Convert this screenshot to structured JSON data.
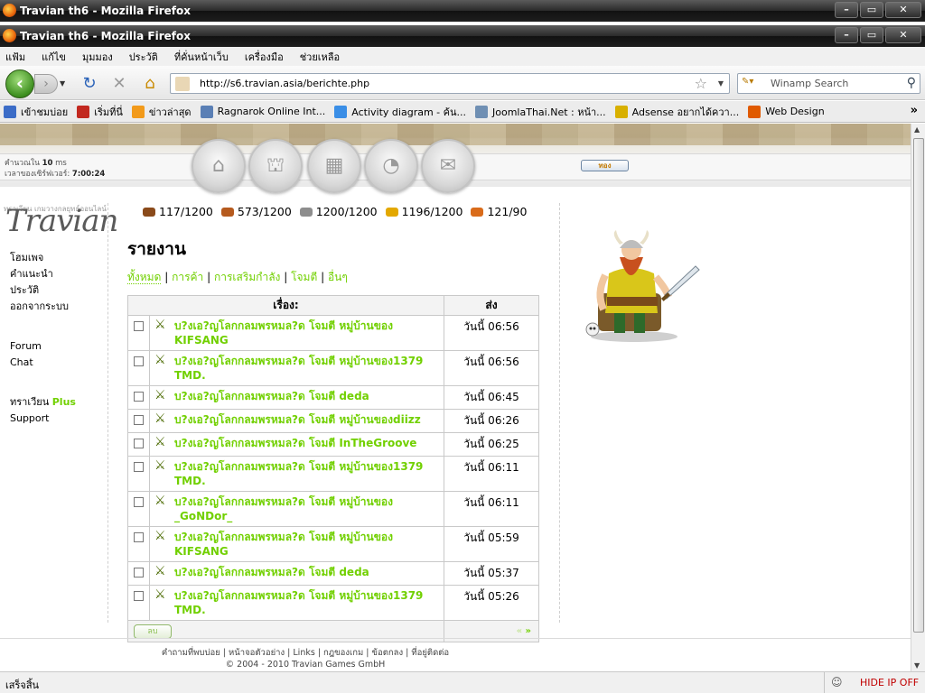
{
  "window": {
    "back_title": "Travian th6 - Mozilla Firefox",
    "title": "Travian th6 - Mozilla Firefox",
    "controls": [
      "–",
      "▭",
      "✕"
    ]
  },
  "menu": [
    "แฟ้ม",
    "แก้ไข",
    "มุมมอง",
    "ประวัติ",
    "ที่คั่นหน้าเว็บ",
    "เครื่องมือ",
    "ช่วยเหลือ"
  ],
  "toolbar": {
    "url": "http://s6.travian.asia/berichte.php",
    "search_placeholder": "Winamp Search"
  },
  "bookmarks": [
    {
      "label": "เข้าชมบ่อย",
      "icon": "bookmark-folder-icon",
      "color": "#3b6cc7"
    },
    {
      "label": "เริ่มที่นี่",
      "icon": "firefox-icon",
      "color": "#c2281f"
    },
    {
      "label": "ข่าวล่าสุด",
      "icon": "rss-icon",
      "color": "#f29a1a"
    },
    {
      "label": "Ragnarok Online Int...",
      "icon": "ragnarok-icon",
      "color": "#5a7fb5"
    },
    {
      "label": "Activity diagram - ค้น...",
      "icon": "google-icon",
      "color": "#3a8ee6"
    },
    {
      "label": "JoomlaThai.Net : หน้า...",
      "icon": "joomla-icon",
      "color": "#6f8fb3"
    },
    {
      "label": "Adsense อยากได้ควา...",
      "icon": "adsense-icon",
      "color": "#d8b000"
    },
    {
      "label": "Web Design",
      "icon": "hostgator-icon",
      "color": "#e05a00"
    }
  ],
  "bookmarks_more": "»",
  "header": {
    "ms_label": "คำนวณใน",
    "ms_value": "10",
    "ms_unit": "ms",
    "server_time_label": "เวลาของเซิร์ฟเวอร์:",
    "server_time": "7:00:24",
    "gold_button": "ทอง",
    "nav_icons": [
      "village-overview-icon",
      "village-center-icon",
      "map-icon",
      "statistics-icon",
      "reports-icon"
    ]
  },
  "logo": {
    "text": "Travian",
    "subtitle": "ทราเวียน เกมวางกลยุทธ์ออนไลน์"
  },
  "leftnav": {
    "group1": [
      "โฮมเพจ",
      "คำแนะนำ",
      "ประวัติ",
      "ออกจากระบบ"
    ],
    "group2": [
      "Forum",
      "Chat"
    ],
    "plus_prefix": "ทราเวียน",
    "plus": "Plus",
    "support": "Support"
  },
  "resources": [
    {
      "name": "wood",
      "value": "117/1200",
      "color": "#8a4a1a"
    },
    {
      "name": "clay",
      "value": "573/1200",
      "color": "#b55a1e"
    },
    {
      "name": "iron",
      "value": "1200/1200",
      "color": "#8d8d8d"
    },
    {
      "name": "crop",
      "value": "1196/1200",
      "color": "#e3a800"
    },
    {
      "name": "crop-consumption",
      "value": "121/90",
      "color": "#d96b1a"
    }
  ],
  "page": {
    "title": "รายงาน",
    "tabs": [
      "ทั้งหมด",
      "การค้า",
      "การเสริมกำลัง",
      "โจมตี",
      "อื่นๆ"
    ],
    "col_subject": "เรื่อง:",
    "col_sent": "ส่ง",
    "delete_button": "ลบ",
    "pager_prev": "«",
    "pager_next": "»"
  },
  "reports": [
    {
      "l1": "บ?งเอ?ญโลกกลมพรหมล?ด โจมตี หมู่บ้านของ",
      "l2": "KIFSANG",
      "time": "วันนี้ 06:56"
    },
    {
      "l1": "บ?งเอ?ญโลกกลมพรหมล?ด โจมตี หมู่บ้านของ1379",
      "l2": "TMD.",
      "time": "วันนี้ 06:56"
    },
    {
      "l1": "บ?งเอ?ญโลกกลมพรหมล?ด โจมตี deda",
      "l2": "",
      "time": "วันนี้ 06:45"
    },
    {
      "l1": "บ?งเอ?ญโลกกลมพรหมล?ด โจมตี หมู่บ้านของdiizz",
      "l2": "",
      "time": "วันนี้ 06:26"
    },
    {
      "l1": "บ?งเอ?ญโลกกลมพรหมล?ด โจมตี InTheGroove",
      "l2": "",
      "time": "วันนี้ 06:25"
    },
    {
      "l1": "บ?งเอ?ญโลกกลมพรหมล?ด โจมตี หมู่บ้านของ1379",
      "l2": "TMD.",
      "time": "วันนี้ 06:11"
    },
    {
      "l1": "บ?งเอ?ญโลกกลมพรหมล?ด โจมตี หมู่บ้านของ",
      "l2": "_GoNDor_",
      "time": "วันนี้ 06:11"
    },
    {
      "l1": "บ?งเอ?ญโลกกลมพรหมล?ด โจมตี หมู่บ้านของ",
      "l2": "KIFSANG",
      "time": "วันนี้ 05:59"
    },
    {
      "l1": "บ?งเอ?ญโลกกลมพรหมล?ด โจมตี deda",
      "l2": "",
      "time": "วันนี้ 05:37"
    },
    {
      "l1": "บ?งเอ?ญโลกกลมพรหมล?ด โจมตี หมู่บ้านของ1379",
      "l2": "TMD.",
      "time": "วันนี้ 05:26"
    }
  ],
  "footer": {
    "links": [
      "คำถามที่พบบ่อย",
      "หน้าจอตัวอย่าง",
      "Links",
      "กฎของเกม",
      "ข้อตกลง",
      "ที่อยู่ติดต่อ"
    ],
    "copyright": "© 2004 - 2010 Travian Games GmbH"
  },
  "status": {
    "text": "เสร็จสิ้น",
    "hide_ip": "HIDE IP OFF"
  },
  "colors": {
    "link_green": "#71d000",
    "status_red": "#c00000"
  }
}
